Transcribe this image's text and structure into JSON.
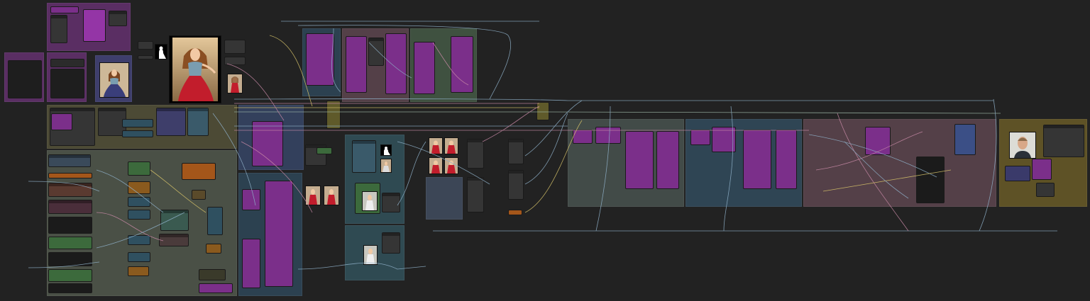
{
  "app": {
    "name": "",
    "accent_colors": {
      "group_purple": "#5a2e63",
      "group_olive": "#4c4a35",
      "group_grey_green": "#4a5046",
      "group_teal": "#2c4150",
      "group_blue": "#33405c",
      "group_mauve": "#544048",
      "group_gold": "#5e5226",
      "node_magenta": "#7b2f8a",
      "wire_blue": "#8fb0c8",
      "wire_pink": "#c98aa7",
      "wire_yellow": "#d8c46a",
      "canvas": "#222222"
    },
    "icons": [
      "portrait-image-icon",
      "mask-silhouette-icon",
      "face-photo-icon"
    ]
  }
}
